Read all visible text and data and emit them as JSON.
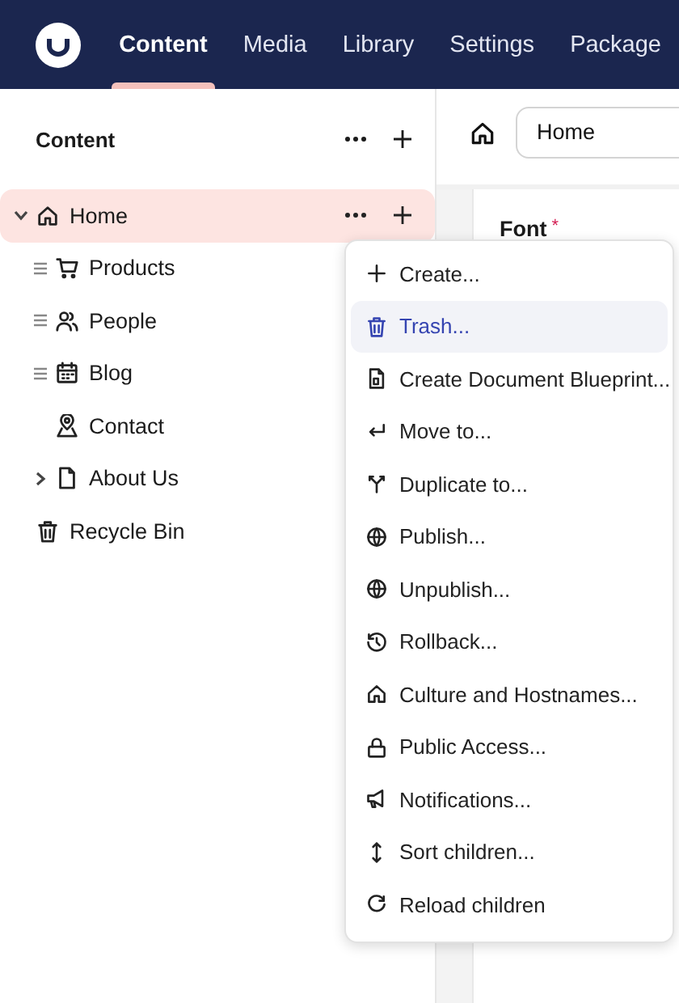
{
  "header": {
    "tabs": [
      {
        "label": "Content",
        "selected": true
      },
      {
        "label": "Media",
        "selected": false
      },
      {
        "label": "Library",
        "selected": false
      },
      {
        "label": "Settings",
        "selected": false
      },
      {
        "label": "Package",
        "selected": false
      }
    ]
  },
  "sidebar": {
    "title": "Content",
    "tree": [
      {
        "label": "Home",
        "selected": true,
        "expanded": true,
        "children": [
          {
            "label": "Products",
            "selected": false,
            "draggable": true
          },
          {
            "label": "People",
            "selected": false,
            "draggable": true
          },
          {
            "label": "Blog",
            "selected": false,
            "draggable": true
          },
          {
            "label": "Contact",
            "selected": false
          },
          {
            "label": "About Us",
            "selected": false,
            "expanded": false
          }
        ]
      },
      {
        "label": "Recycle Bin",
        "selected": false
      }
    ]
  },
  "main": {
    "name_field": {
      "value": "Home"
    },
    "field_label": "Font",
    "required_mark": "*"
  },
  "context_menu": {
    "items": [
      {
        "label": "Create...",
        "selected": false
      },
      {
        "label": "Trash...",
        "selected": true
      },
      {
        "label": "Create Document Blueprint...",
        "selected": false
      },
      {
        "label": "Move to...",
        "selected": false
      },
      {
        "label": "Duplicate to...",
        "selected": false
      },
      {
        "label": "Publish...",
        "selected": false
      },
      {
        "label": "Unpublish...",
        "selected": false
      },
      {
        "label": "Rollback...",
        "selected": false
      },
      {
        "label": "Culture and Hostnames...",
        "selected": false
      },
      {
        "label": "Public Access...",
        "selected": false
      },
      {
        "label": "Notifications...",
        "selected": false
      },
      {
        "label": "Sort children...",
        "selected": false
      },
      {
        "label": "Reload children",
        "selected": false
      }
    ]
  }
}
